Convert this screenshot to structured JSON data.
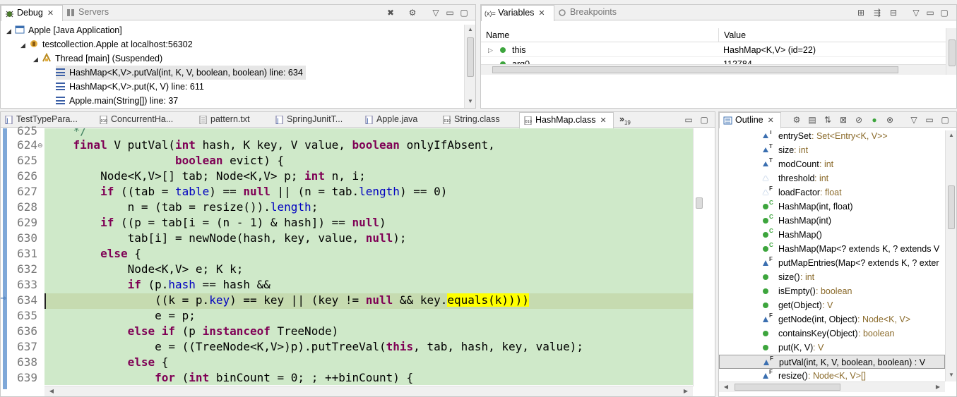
{
  "debug": {
    "tabs": [
      {
        "label": "Debug",
        "active": true,
        "close": "✕"
      },
      {
        "label": "Servers",
        "active": false
      }
    ],
    "tree": [
      {
        "label": "Apple [Java Application]",
        "level": 0,
        "icon": "java-app-icon"
      },
      {
        "label": "testcollection.Apple at localhost:56302",
        "level": 1,
        "icon": "jvm-icon"
      },
      {
        "label": "Thread [main] (Suspended)",
        "level": 2,
        "icon": "thread-icon"
      },
      {
        "label": "HashMap<K,V>.putVal(int, K, V, boolean, boolean) line: 634",
        "level": 3,
        "icon": "stack-frame-icon",
        "selected": true
      },
      {
        "label": "HashMap<K,V>.put(K, V) line: 611",
        "level": 3,
        "icon": "stack-frame-icon"
      },
      {
        "label": "Apple.main(String[]) line: 37",
        "level": 3,
        "icon": "stack-frame-icon"
      }
    ]
  },
  "variables": {
    "tabs": [
      {
        "label": "Variables",
        "active": true,
        "prefix": "(x)=",
        "close": "✕"
      },
      {
        "label": "Breakpoints",
        "active": false
      }
    ],
    "columns": [
      "Name",
      "Value"
    ],
    "rows": [
      {
        "name": "this",
        "value": "HashMap<K,V>  (id=22)"
      },
      {
        "name": "arg0",
        "value": "112784"
      }
    ]
  },
  "editor": {
    "tabs": [
      {
        "label": "TestTypePara...",
        "icon": "java-file-icon"
      },
      {
        "label": "ConcurrentHa...",
        "icon": "class-file-icon"
      },
      {
        "label": "pattern.txt",
        "icon": "text-file-icon"
      },
      {
        "label": "SpringJunitT...",
        "icon": "java-file-icon"
      },
      {
        "label": "Apple.java",
        "icon": "java-file-icon"
      },
      {
        "label": "String.class",
        "icon": "class-file-icon"
      },
      {
        "label": "HashMap.class",
        "icon": "class-file-icon",
        "active": true,
        "close": "✕"
      }
    ],
    "overflow_label": "»",
    "overflow_count": "19",
    "current_line": "634",
    "lines": [
      {
        "n": "625",
        "text": "    */"
      },
      {
        "n": "624",
        "text": "    final V putVal(int hash, K key, V value, boolean onlyIfAbsent,"
      },
      {
        "n": "625",
        "text": "                   boolean evict) {"
      },
      {
        "n": "626",
        "text": "        Node<K,V>[] tab; Node<K,V> p; int n, i;"
      },
      {
        "n": "627",
        "text": "        if ((tab = table) == null || (n = tab.length) == 0)"
      },
      {
        "n": "628",
        "text": "            n = (tab = resize()).length;"
      },
      {
        "n": "629",
        "text": "        if ((p = tab[i = (n - 1) & hash]) == null)"
      },
      {
        "n": "630",
        "text": "            tab[i] = newNode(hash, key, value, null);"
      },
      {
        "n": "631",
        "text": "        else {"
      },
      {
        "n": "632",
        "text": "            Node<K,V> e; K k;"
      },
      {
        "n": "633",
        "text": "            if (p.hash == hash &&"
      },
      {
        "n": "634",
        "text": "                ((k = p.key) == key || (key != null && key.equals(k))))"
      },
      {
        "n": "635",
        "text": "                e = p;"
      },
      {
        "n": "636",
        "text": "            else if (p instanceof TreeNode)"
      },
      {
        "n": "637",
        "text": "                e = ((TreeNode<K,V>)p).putTreeVal(this, tab, hash, key, value);"
      },
      {
        "n": "638",
        "text": "            else {"
      },
      {
        "n": "639",
        "text": "                for (int binCount = 0; ; ++binCount) {"
      }
    ],
    "highlighted_expression": "equals(k))))",
    "colors": {
      "background": "#cfe9c9",
      "keyword": "#7f0055",
      "field": "#0000c0",
      "highlight": "#ffff00"
    }
  },
  "outline": {
    "tab": {
      "label": "Outline",
      "close": "✕"
    },
    "items": [
      {
        "name": "entrySet",
        "type": " : Set<Entry<K, V>>",
        "icon": "field-transient-icon",
        "mod": "T"
      },
      {
        "name": "size",
        "type": " : int",
        "icon": "field-transient-icon",
        "mod": "T"
      },
      {
        "name": "modCount",
        "type": " : int",
        "icon": "field-transient-icon",
        "mod": "T"
      },
      {
        "name": "threshold",
        "type": " : int",
        "icon": "field-default-icon",
        "mod": ""
      },
      {
        "name": "loadFactor",
        "type": " : float",
        "icon": "field-final-icon",
        "mod": "F"
      },
      {
        "name": "HashMap(int, float)",
        "type": "",
        "icon": "constructor-icon",
        "mod": "C"
      },
      {
        "name": "HashMap(int)",
        "type": "",
        "icon": "constructor-icon",
        "mod": "C"
      },
      {
        "name": "HashMap()",
        "type": "",
        "icon": "constructor-icon",
        "mod": "C"
      },
      {
        "name": "HashMap(Map<? extends K, ? extends V",
        "type": "",
        "icon": "constructor-icon",
        "mod": "C"
      },
      {
        "name": "putMapEntries(Map<? extends K, ? exter",
        "type": "",
        "icon": "method-final-icon",
        "mod": "F"
      },
      {
        "name": "size()",
        "type": " : int",
        "icon": "method-public-icon",
        "mod": ""
      },
      {
        "name": "isEmpty()",
        "type": " : boolean",
        "icon": "method-public-icon",
        "mod": ""
      },
      {
        "name": "get(Object)",
        "type": " : V",
        "icon": "method-public-icon",
        "mod": ""
      },
      {
        "name": "getNode(int, Object)",
        "type": " : Node<K, V>",
        "icon": "method-final-icon",
        "mod": "F"
      },
      {
        "name": "containsKey(Object)",
        "type": " : boolean",
        "icon": "method-public-icon",
        "mod": ""
      },
      {
        "name": "put(K, V)",
        "type": " : V",
        "icon": "method-public-icon",
        "mod": ""
      },
      {
        "name": "putVal(int, K, V, boolean, boolean) : V",
        "type": "",
        "icon": "method-final-icon",
        "mod": "F",
        "selected": true
      },
      {
        "name": "resize()",
        "type": " : Node<K, V>[]",
        "icon": "method-final-icon",
        "mod": "F"
      }
    ]
  }
}
